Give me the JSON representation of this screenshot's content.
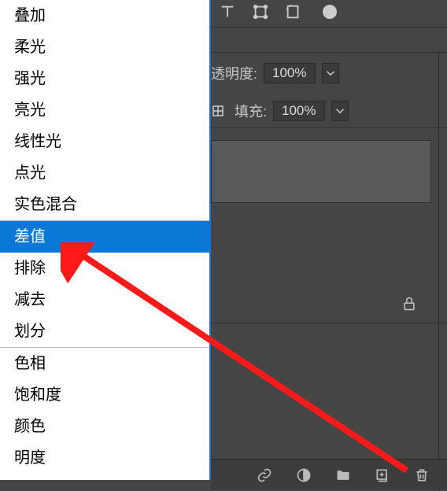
{
  "menu": {
    "group1": [
      "叠加",
      "柔光",
      "强光",
      "亮光",
      "线性光",
      "点光",
      "实色混合"
    ],
    "group2": [
      "差值",
      "排除",
      "减去",
      "划分"
    ],
    "group3": [
      "色相",
      "饱和度",
      "颜色",
      "明度"
    ],
    "selected": "差值"
  },
  "panel": {
    "opacity_label": "透明度:",
    "fill_label": "填充:",
    "opacity_value": "100%",
    "fill_value": "100%"
  }
}
